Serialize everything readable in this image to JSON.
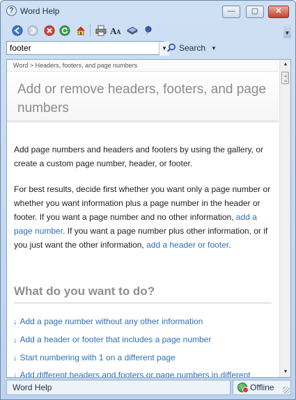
{
  "window": {
    "title": "Word Help"
  },
  "title_buttons": {
    "minimize": "—",
    "maximize": "▢",
    "close": "✕"
  },
  "toolbar": {
    "buttons": [
      "back-icon",
      "forward-icon",
      "stop-icon",
      "refresh-icon",
      "home-icon",
      "print-icon",
      "font-size-icon",
      "table-of-contents-icon",
      "pin-icon"
    ]
  },
  "search": {
    "value": "footer",
    "button_label": "Search"
  },
  "breadcrumb": "Word > Headers, footers, and page numbers",
  "article": {
    "title": "Add or remove headers, footers, and page numbers",
    "intro": "Add page numbers and headers and footers by using the gallery, or create a custom page number, header, or footer.",
    "p2_part1": "For best results, decide first whether you want only a page number or whether you want information plus a page number in the header or footer. If you want a page number and no other information, ",
    "p2_link1": "add a page number",
    "p2_part2": ". If you want a page number plus other information, or if you just want the other information, ",
    "p2_link2": "add a header or footer",
    "p2_part3": ".",
    "section_heading": "What do you want to do?",
    "jump_links": [
      "Add a page number without any other information",
      "Add a header or footer that includes a page number",
      "Start numbering with 1 on a different page",
      "Add different headers and footers or page numbers in different"
    ]
  },
  "statusbar": {
    "left": "Word Help",
    "right": "Offline"
  },
  "colors": {
    "link": "#2f6fb7",
    "title_gray": "#8a8a8a",
    "chrome": "#bcd3ee"
  }
}
